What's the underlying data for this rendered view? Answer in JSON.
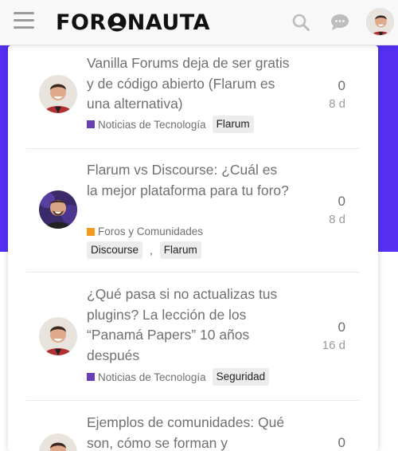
{
  "header": {
    "logo_text_left": "FOR",
    "logo_text_right": "NAUTA",
    "logo_full": "FORONAUTA",
    "icons": [
      "hamburger-icon",
      "search-icon",
      "chat-icon",
      "user-avatar"
    ]
  },
  "colors": {
    "accent": "#5530f2",
    "category_tecnologia": "#6a3fb5",
    "category_foros": "#f39a1d"
  },
  "discussions": [
    {
      "title": "Vanilla Forums deja de ser gratis y de código abierto (Flarum es una alternativa)",
      "category": "Noticias de Tecnología",
      "tags": [
        "Flarum"
      ],
      "replies": "0",
      "ago": "8 d"
    },
    {
      "title": "Flarum vs Discourse: ¿Cuál es la mejor plataforma para tu foro?",
      "category": "Foros y Comunidades",
      "tags": [
        "Discourse",
        "Flarum"
      ],
      "separator": ",",
      "replies": "0",
      "ago": "8 d"
    },
    {
      "title": "¿Qué pasa si no actualizas tus plugins? La lección de los “Panamá Papers” 10 años después",
      "category": "Noticias de Tecnología",
      "tags": [
        "Seguridad"
      ],
      "replies": "0",
      "ago": "16 d"
    },
    {
      "title": "Ejemplos de comunidades: Qué son, cómo se forman y",
      "replies": "0"
    }
  ]
}
